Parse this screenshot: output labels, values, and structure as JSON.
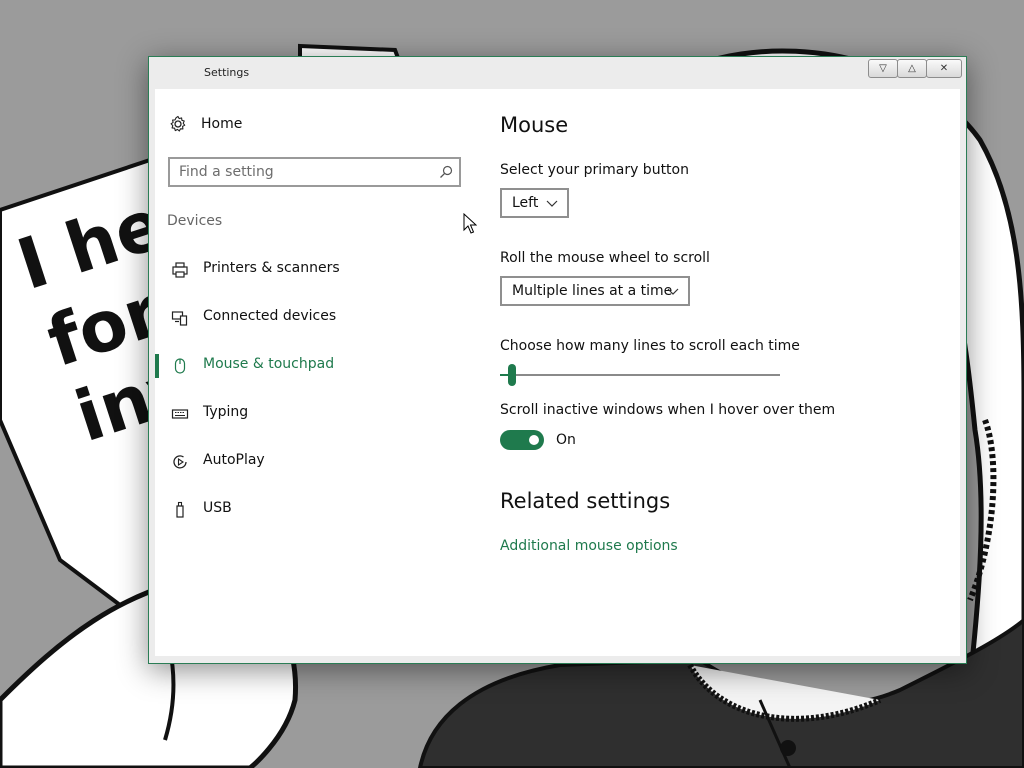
{
  "background": {
    "paper_lines": [
      "I her",
      "form",
      "inv"
    ]
  },
  "window": {
    "title": "Settings",
    "controls": {
      "minimize_glyph": "▽",
      "maximize_glyph": "△",
      "close_glyph": "✕"
    }
  },
  "sidebar": {
    "home_label": "Home",
    "search_placeholder": "Find a setting",
    "group_label": "Devices",
    "items": [
      {
        "label": "Printers & scanners",
        "icon": "printer-icon",
        "active": false
      },
      {
        "label": "Connected devices",
        "icon": "connected-devices-icon",
        "active": false
      },
      {
        "label": "Mouse & touchpad",
        "icon": "mouse-icon",
        "active": true
      },
      {
        "label": "Typing",
        "icon": "keyboard-icon",
        "active": false
      },
      {
        "label": "AutoPlay",
        "icon": "autoplay-icon",
        "active": false
      },
      {
        "label": "USB",
        "icon": "usb-icon",
        "active": false
      }
    ]
  },
  "main": {
    "title": "Mouse",
    "primary_button": {
      "label": "Select your primary button",
      "value": "Left"
    },
    "wheel_scroll": {
      "label": "Roll the mouse wheel to scroll",
      "value": "Multiple lines at a time"
    },
    "lines_slider": {
      "label": "Choose how many lines to scroll each time",
      "fraction": 0.03
    },
    "inactive_scroll": {
      "label": "Scroll inactive windows when I hover over them",
      "state": "On"
    },
    "related": {
      "title": "Related settings",
      "link": "Additional mouse options"
    }
  },
  "colors": {
    "accent": "#1f7a4d"
  }
}
